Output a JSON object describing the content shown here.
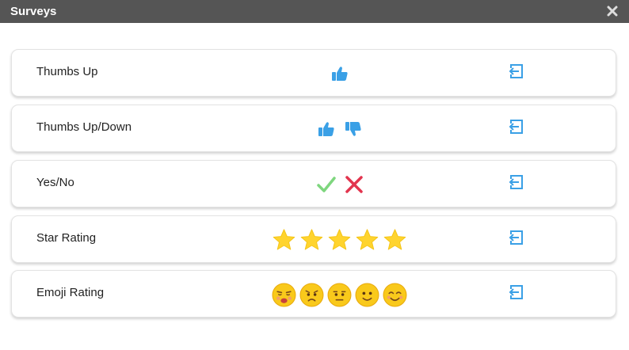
{
  "window": {
    "title": "Surveys",
    "close_icon": "close-icon"
  },
  "colors": {
    "titlebar": "#555555",
    "accent_blue": "#3aa0e6",
    "check_green": "#7ed67e",
    "cross_red": "#e2344e",
    "star_yellow": "#ffd42e",
    "emoji_yellow": "#f9c91b"
  },
  "surveys": [
    {
      "label": "Thumbs Up",
      "preview_icons": [
        "thumbs-up-icon"
      ],
      "action_icon": "insert-icon"
    },
    {
      "label": "Thumbs Up/Down",
      "preview_icons": [
        "thumbs-up-icon",
        "thumbs-down-icon"
      ],
      "action_icon": "insert-icon"
    },
    {
      "label": "Yes/No",
      "preview_icons": [
        "check-icon",
        "cross-icon"
      ],
      "action_icon": "insert-icon"
    },
    {
      "label": "Star Rating",
      "preview_icons": [
        "star-icon",
        "star-icon",
        "star-icon",
        "star-icon",
        "star-icon"
      ],
      "action_icon": "insert-icon"
    },
    {
      "label": "Emoji Rating",
      "preview_icons": [
        "emoji-tearful-icon",
        "emoji-sad-icon",
        "emoji-neutral-icon",
        "emoji-smile-icon",
        "emoji-happy-icon"
      ],
      "action_icon": "insert-icon"
    }
  ]
}
